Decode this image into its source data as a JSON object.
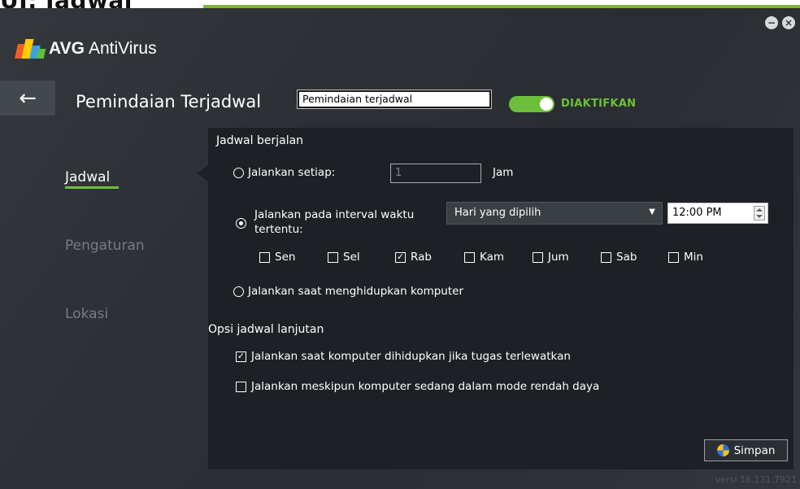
{
  "page_heading": "UI: Jadwal",
  "window": {
    "brand_strong": "AVG",
    "brand_light": "AntiVirus",
    "minimize_glyph": "−",
    "close_glyph": "×"
  },
  "header": {
    "back_glyph": "←",
    "title": "Pemindaian Terjadwal",
    "name_value": "Pemindaian terjadwal",
    "toggle_label": "DIAKTIFKAN",
    "toggle_on": true
  },
  "nav": {
    "items": [
      {
        "label": "Jadwal",
        "active": true
      },
      {
        "label": "Pengaturan",
        "active": false
      },
      {
        "label": "Lokasi",
        "active": false
      }
    ]
  },
  "schedule": {
    "section_title": "Jadwal berjalan",
    "run_every_label": "Jalankan setiap:",
    "run_every_value": "1",
    "run_every_unit": "Jam",
    "run_interval_label_line1": "Jalankan pada interval waktu",
    "run_interval_label_line2": "tertentu:",
    "interval_dropdown_value": "Hari yang dipilih",
    "time_value": "12:00 PM",
    "days": [
      {
        "label": "Sen",
        "checked": false
      },
      {
        "label": "Sel",
        "checked": false
      },
      {
        "label": "Rab",
        "checked": true
      },
      {
        "label": "Kam",
        "checked": false
      },
      {
        "label": "Jum",
        "checked": false
      },
      {
        "label": "Sab",
        "checked": false
      },
      {
        "label": "Min",
        "checked": false
      }
    ],
    "run_at_startup_label": "Jalankan saat menghidupkan komputer",
    "selected_option": "interval"
  },
  "advanced": {
    "section_title": "Opsi jadwal lanjutan",
    "option1_label": "Jalankan saat komputer dihidupkan jika tugas terlewatkan",
    "option1_checked": true,
    "option2_label": "Jalankan meskipun komputer sedang dalam mode rendah daya",
    "option2_checked": false
  },
  "footer": {
    "save_label": "Simpan",
    "version": "versi 16.131.7921"
  },
  "colors": {
    "accent_green": "#6dbf3b",
    "background": "#2e3236",
    "panel": "#1d2125"
  },
  "icons": [
    "avg-logo-icon",
    "back-arrow-icon",
    "minimize-icon",
    "close-icon",
    "dropdown-caret-icon",
    "shield-icon"
  ]
}
